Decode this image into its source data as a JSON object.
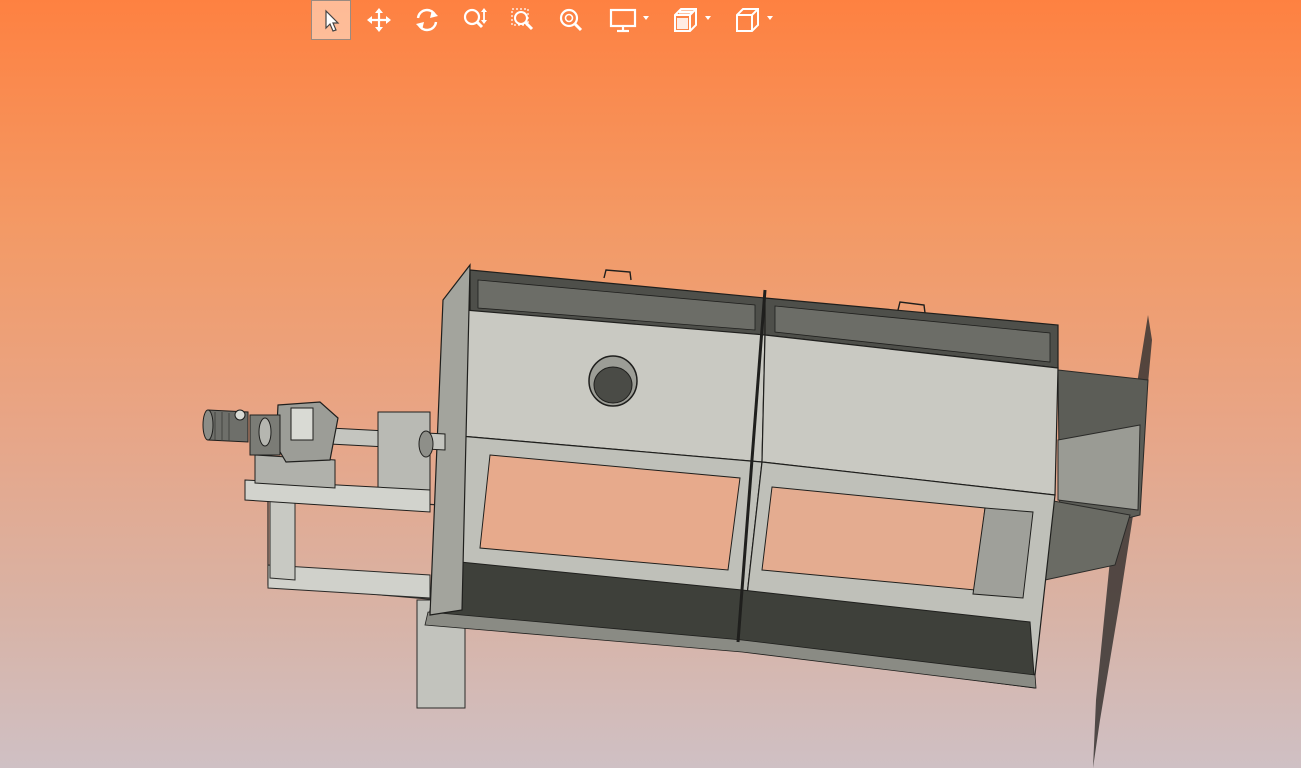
{
  "viewer": {
    "toolbar": {
      "tools": [
        {
          "id": "select",
          "icon": "cursor-arrow-icon",
          "active": true
        },
        {
          "id": "pan",
          "icon": "move-arrows-icon",
          "active": false
        },
        {
          "id": "rotate",
          "icon": "rotate-icon",
          "active": false
        },
        {
          "id": "zoom-in-out",
          "icon": "zoom-up-down-icon",
          "active": false
        },
        {
          "id": "zoom-window",
          "icon": "zoom-window-icon",
          "active": false
        },
        {
          "id": "zoom-fit",
          "icon": "zoom-fit-icon",
          "active": false
        },
        {
          "id": "display-mode",
          "icon": "monitor-icon",
          "dropdown": true
        },
        {
          "id": "section-view",
          "icon": "section-cube-icon",
          "dropdown": true
        },
        {
          "id": "view-orientation",
          "icon": "cube-view-icon",
          "dropdown": true
        }
      ]
    },
    "colors": {
      "background_top": "#fe8141",
      "background_bottom": "#cfc0c4",
      "model_light": "#c9c9c2",
      "model_dark": "#3e403a"
    },
    "model": {
      "description_icon": "3d-machine-assembly"
    }
  }
}
